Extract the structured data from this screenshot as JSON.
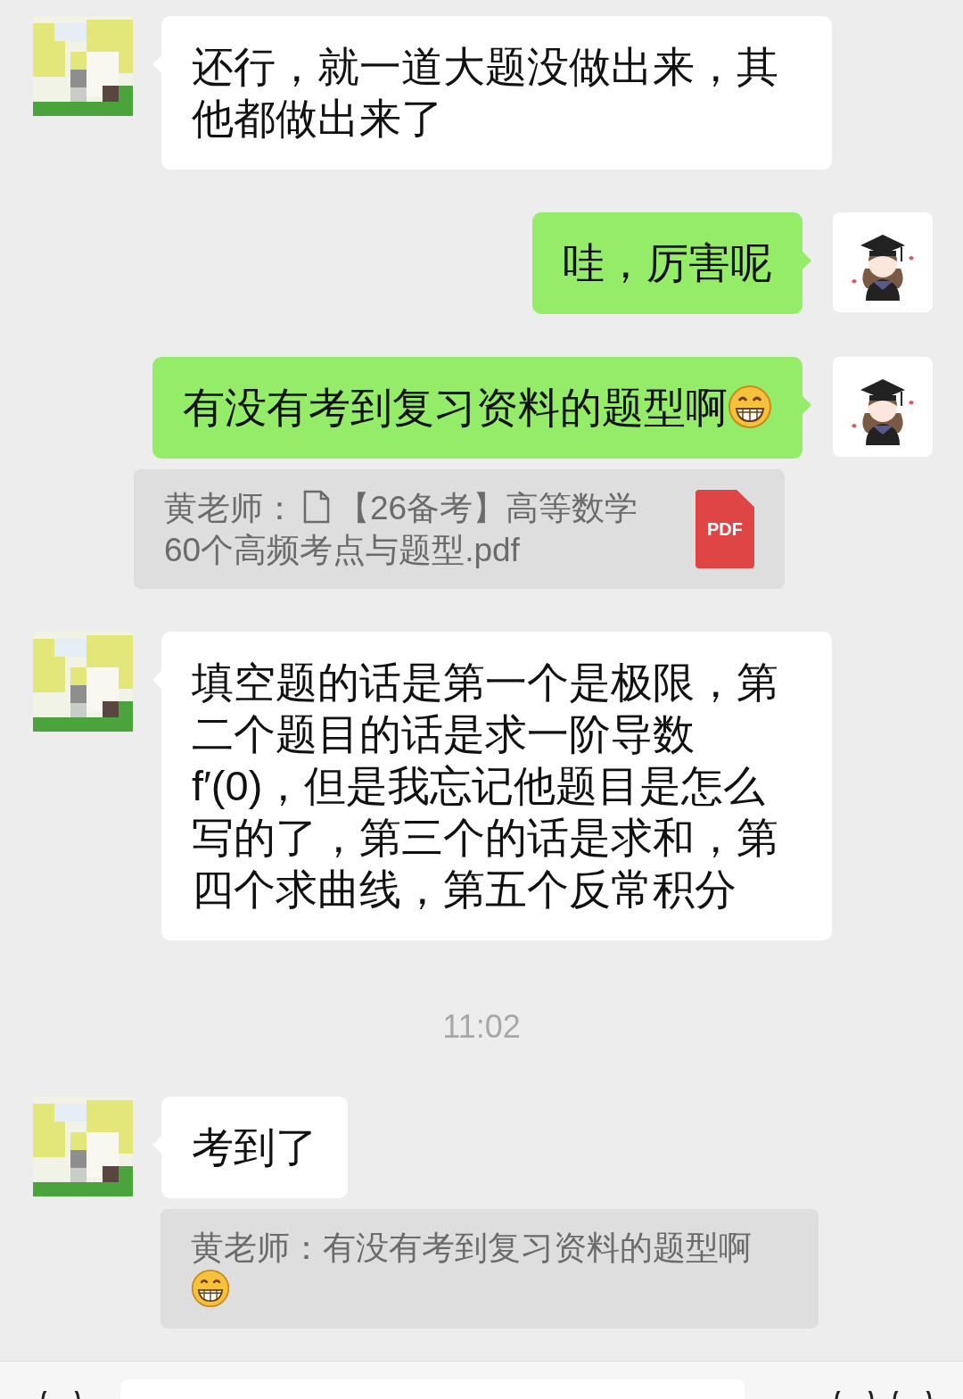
{
  "messages": [
    {
      "kind": "text",
      "outgoing": false,
      "text": "还行，就一道大题没做出来，其他都做出来了",
      "trailing_emoji": false
    },
    {
      "kind": "text",
      "outgoing": true,
      "text": "哇，厉害呢",
      "trailing_emoji": false
    },
    {
      "kind": "text",
      "outgoing": true,
      "text": "有没有考到复习资料的题型啊",
      "trailing_emoji": true
    },
    {
      "kind": "quote",
      "outgoing": true,
      "sender": "黄老师：",
      "lines": [
        "【26备考】高等数学",
        "60个高频考点与题型.pdf"
      ],
      "attachment": "PDF",
      "trailing_emoji": false
    },
    {
      "kind": "text",
      "outgoing": false,
      "text": "填空题的话是第一个是极限，第二个题目的话是求一阶导数 f′(0)，但是我忘记他题目是怎么写的了，第三个的话是求和，第四个求曲线，第五个反常积分",
      "trailing_emoji": false
    },
    {
      "kind": "time",
      "text": "11:02"
    },
    {
      "kind": "text",
      "outgoing": false,
      "text": "考到了",
      "trailing_emoji": false
    },
    {
      "kind": "quote",
      "outgoing": false,
      "sender": "黄老师：",
      "lines": [
        "有没有考到复习资料的题型啊"
      ],
      "trailing_emoji": true
    }
  ]
}
